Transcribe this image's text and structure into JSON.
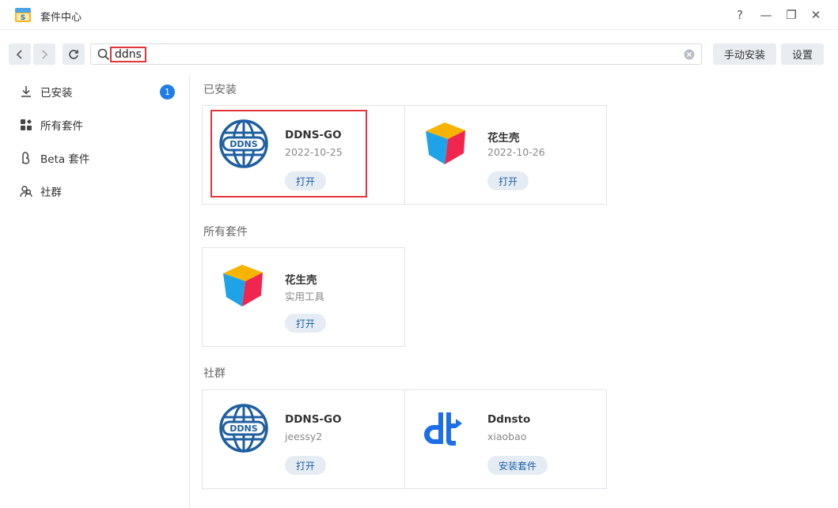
{
  "window": {
    "title": "套件中心",
    "controls": [
      "?",
      "—",
      "❐",
      "✕"
    ]
  },
  "toolbar": {
    "search_value": "ddns",
    "manual_install_label": "手动安装",
    "settings_label": "设置"
  },
  "sidebar": {
    "items": [
      {
        "label": "已安装",
        "icon": "download-icon",
        "badge": "1"
      },
      {
        "label": "所有套件",
        "icon": "grid-icon"
      },
      {
        "label": "Beta 套件",
        "icon": "beta-icon"
      },
      {
        "label": "社群",
        "icon": "community-icon"
      }
    ]
  },
  "sections": {
    "installed": {
      "title": "已安装",
      "packages": [
        {
          "name": "DDNS-GO",
          "sub": "2022-10-25",
          "button": "打开",
          "icon": "ddns-globe-icon"
        },
        {
          "name": "花生壳",
          "sub": "2022-10-26",
          "button": "打开",
          "icon": "cube-icon"
        }
      ]
    },
    "all": {
      "title": "所有套件",
      "packages": [
        {
          "name": "花生壳",
          "sub": "实用工具",
          "button": "打开",
          "icon": "cube-icon"
        }
      ]
    },
    "community": {
      "title": "社群",
      "packages": [
        {
          "name": "DDNS-GO",
          "sub": "jeessy2",
          "button": "打开",
          "icon": "ddns-globe-icon"
        },
        {
          "name": "Ddnsto",
          "sub": "xiaobao",
          "button": "安装套件",
          "icon": "dt-logo-icon"
        }
      ]
    }
  },
  "colors": {
    "accent": "#1f7de6",
    "highlight": "#e1353a",
    "button_bg": "#e6ecf3",
    "button_text": "#1a5fa8"
  }
}
